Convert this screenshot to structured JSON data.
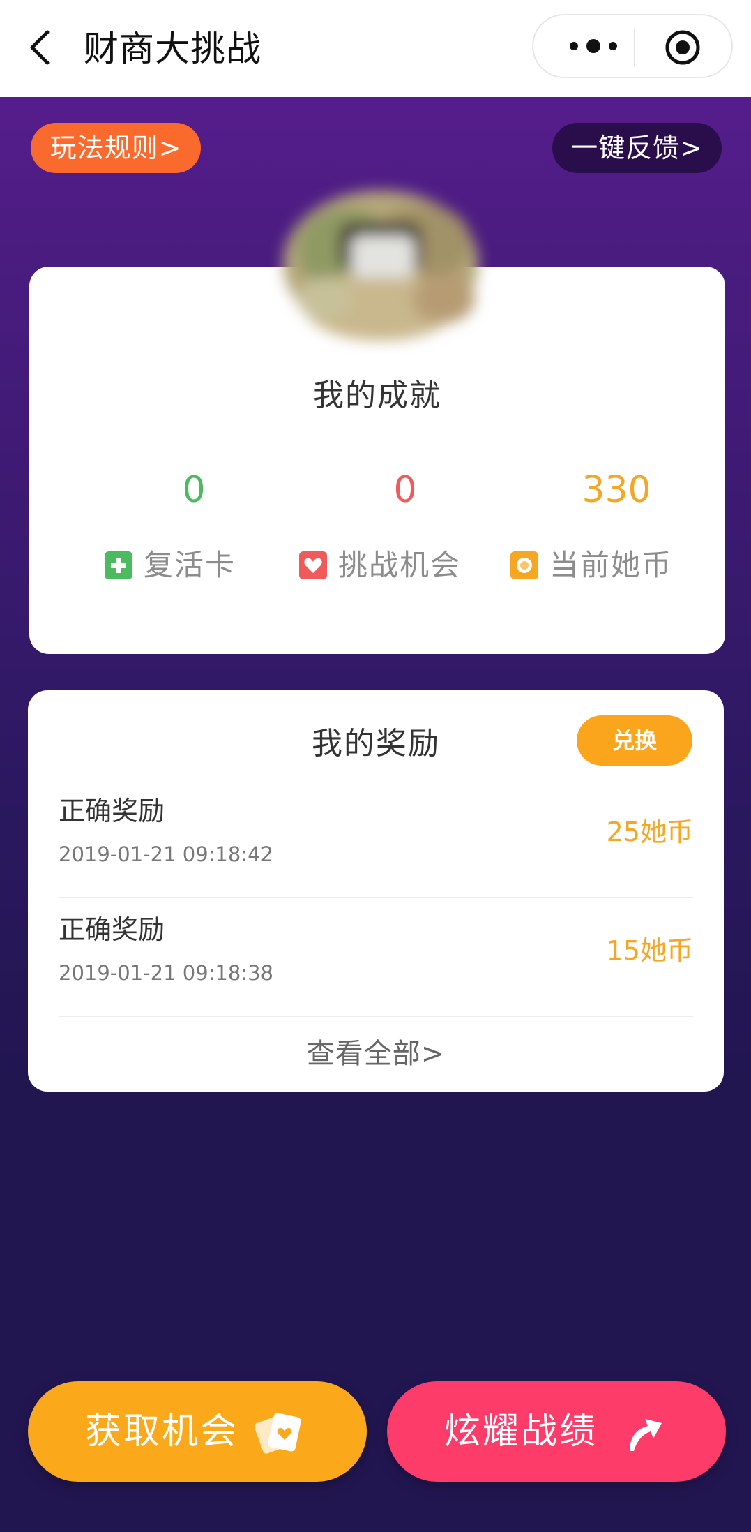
{
  "navbar": {
    "title": "财商大挑战",
    "back_icon": "back-arrow-icon",
    "more_icon": "more-dots-icon",
    "close_icon": "target-circle-icon"
  },
  "header": {
    "rules_label": "玩法规则>",
    "feedback_label": "一键反馈>"
  },
  "achievements": {
    "title": "我的成就",
    "stats": [
      {
        "value": "0",
        "label": "复活卡",
        "color": "#4cbb60",
        "icon": "plus-card-icon"
      },
      {
        "value": "0",
        "label": "挑战机会",
        "color": "#f05a5a",
        "icon": "heart-icon"
      },
      {
        "value": "330",
        "label": "当前她币",
        "color": "#f5a623",
        "icon": "coin-icon"
      }
    ]
  },
  "rewards": {
    "title": "我的奖励",
    "exchange_label": "兑换",
    "items": [
      {
        "name": "正确奖励",
        "time": "2019-01-21 09:18:42",
        "amount": "25她币"
      },
      {
        "name": "正确奖励",
        "time": "2019-01-21 09:18:38",
        "amount": "15她币"
      }
    ],
    "view_all_label": "查看全部>"
  },
  "actions": {
    "get_chance_label": "获取机会",
    "get_chance_icon": "cards-heart-icon",
    "show_off_label": "炫耀战绩",
    "show_off_icon": "share-arrow-icon"
  },
  "colors": {
    "accent_orange": "#fba91b",
    "accent_pink": "#fd3c6a",
    "rules_orange": "#fb6a2d",
    "bg_purple": "#4a1c80"
  }
}
